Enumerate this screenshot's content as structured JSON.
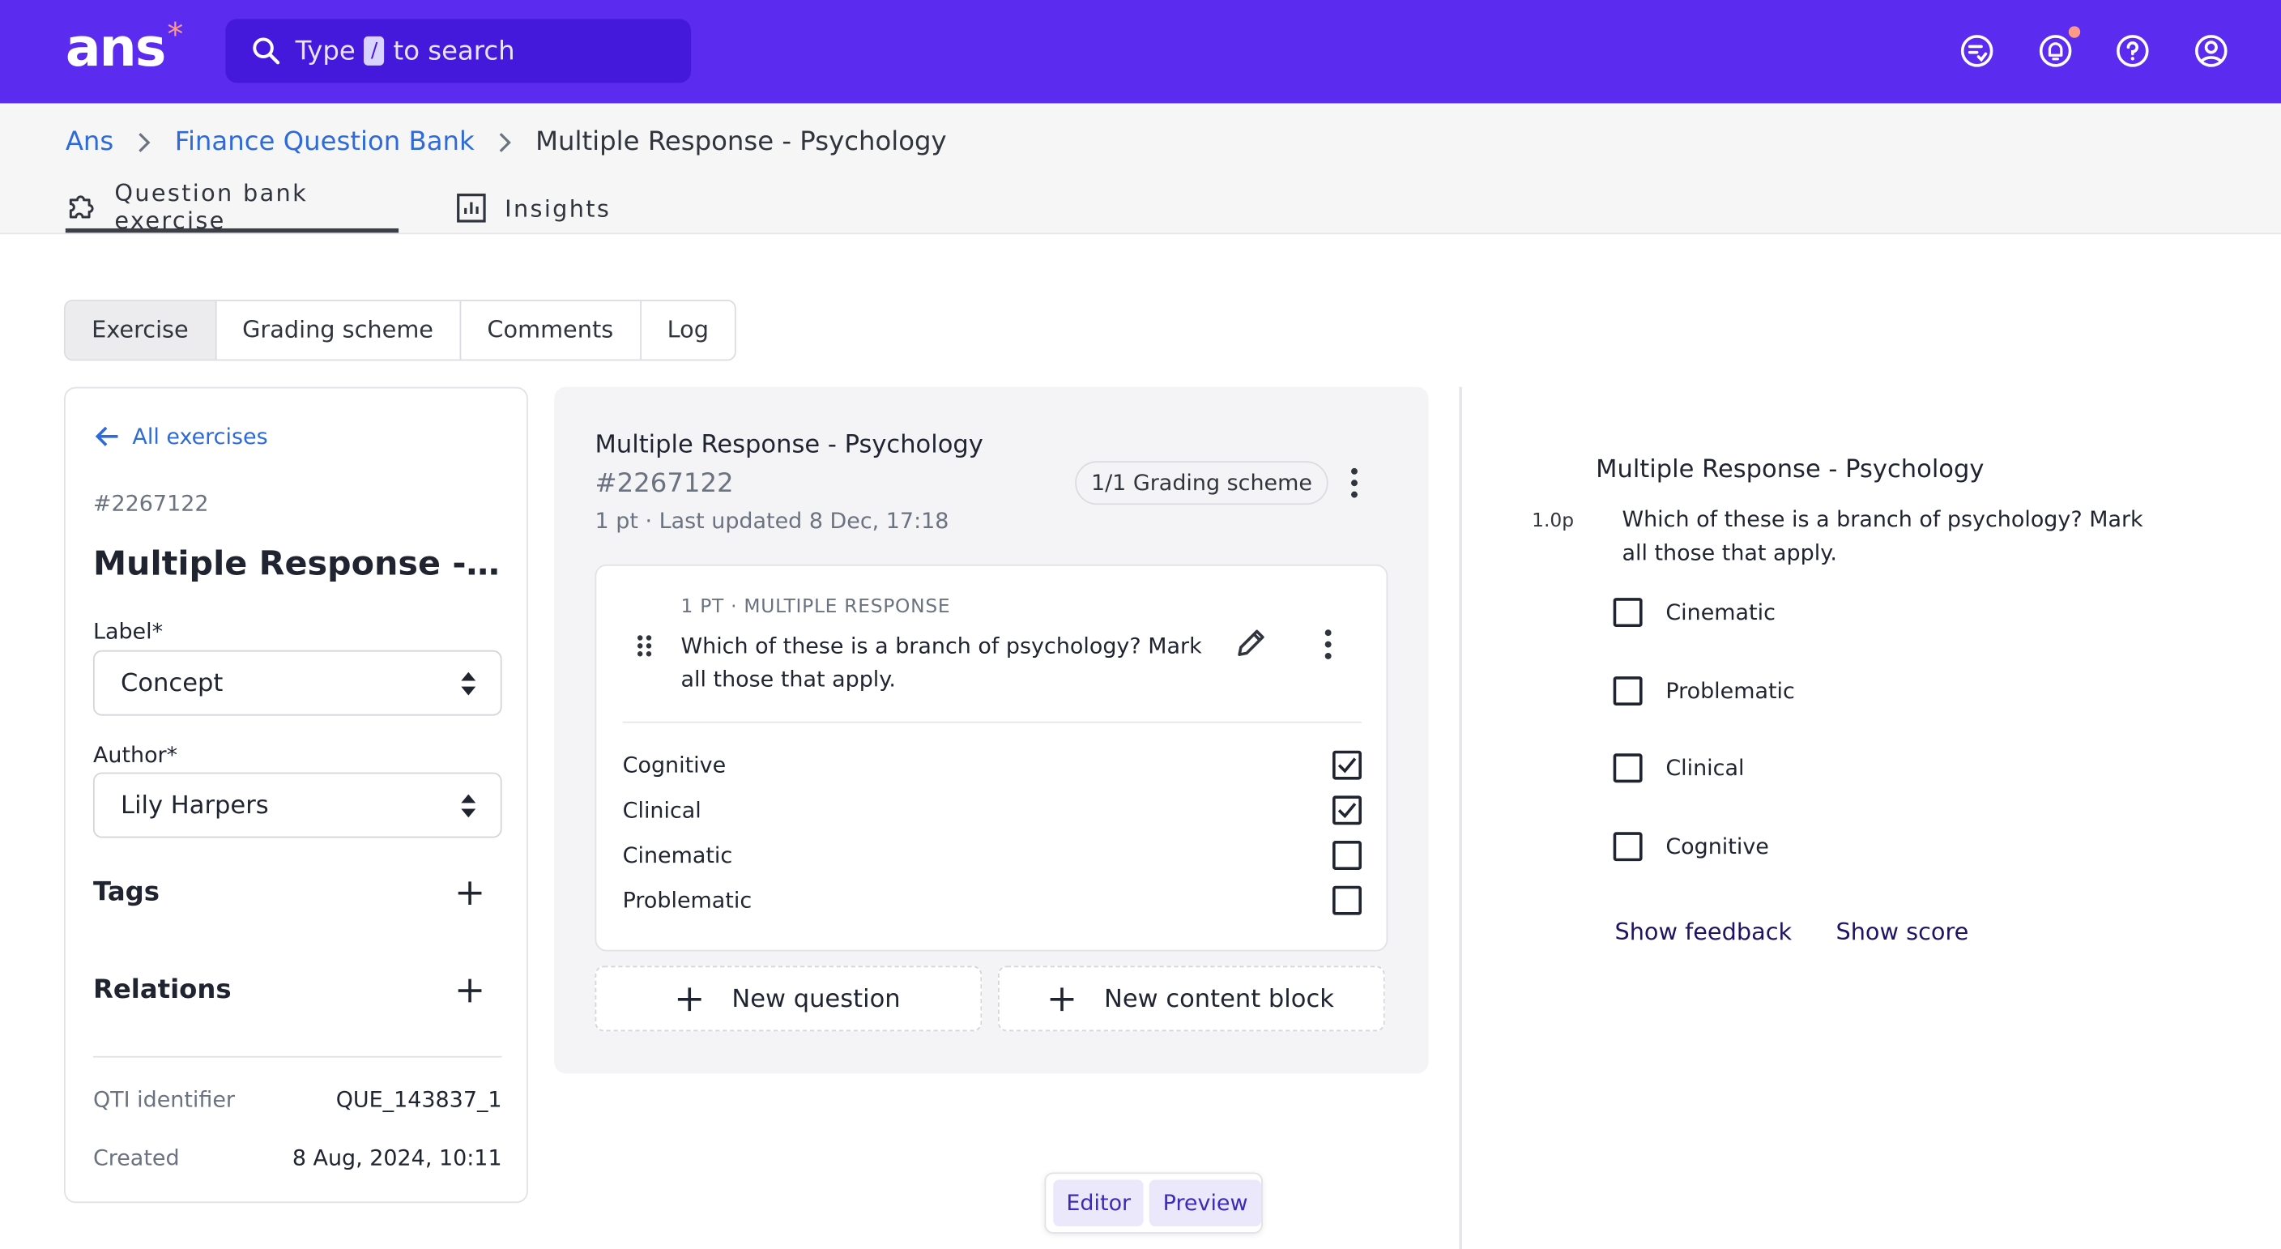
{
  "app": {
    "logo": "ans",
    "logo_star": "*",
    "search": {
      "prefix": "Type",
      "key": "/",
      "suffix": "to search"
    }
  },
  "breadcrumb": [
    "Ans",
    "Finance Question Bank",
    "Multiple Response - Psychology"
  ],
  "page_tabs": [
    "Question bank exercise",
    "Insights"
  ],
  "section_tabs": [
    "Exercise",
    "Grading scheme",
    "Comments",
    "Log"
  ],
  "left_panel": {
    "back_label": "All exercises",
    "exercise_id": "#2267122",
    "title": "Multiple Response - Psychology",
    "label_field": {
      "label": "Label*",
      "value": "Concept"
    },
    "author_field": {
      "label": "Author*",
      "value": "Lily Harpers"
    },
    "tags_label": "Tags",
    "relations_label": "Relations",
    "qti_key": "QTI identifier",
    "qti_value": "QUE_143837_1",
    "created_key": "Created",
    "created_value": "8 Aug, 2024, 10:11"
  },
  "editor": {
    "title": "Multiple Response - Psychology",
    "exercise_id": "#2267122",
    "meta": "1 pt · Last updated 8 Dec, 17:18",
    "grading_pill": "1/1 Grading scheme",
    "question": {
      "kicker": "1 PT · MULTIPLE RESPONSE",
      "text": "Which of these is a branch of psychology? Mark all those that apply.",
      "options": [
        {
          "label": "Cognitive",
          "checked": true
        },
        {
          "label": "Clinical",
          "checked": true
        },
        {
          "label": "Cinematic",
          "checked": false
        },
        {
          "label": "Problematic",
          "checked": false
        }
      ]
    },
    "new_question_label": "New question",
    "new_content_block_label": "New content block"
  },
  "view_toggle": {
    "editor_label": "Editor",
    "preview_label": "Preview"
  },
  "preview": {
    "title": "Multiple Response - Psychology",
    "points": "1.0p",
    "question": "Which of these is a branch of psychology? Mark all those that apply.",
    "options": [
      "Cinematic",
      "Problematic",
      "Clinical",
      "Cognitive"
    ],
    "show_feedback_label": "Show feedback",
    "show_score_label": "Show score"
  },
  "colors": {
    "brand": "#5b2bf0",
    "search_bg": "#4519dc",
    "link": "#2f6ad9",
    "notification_dot": "#ff9a86"
  },
  "icons": [
    "search-icon",
    "checklist-icon",
    "bell-icon",
    "help-icon",
    "account-icon",
    "chevron-right-icon",
    "puzzle-icon",
    "bar-chart-icon",
    "arrow-left-icon",
    "sort-icon",
    "plus-icon",
    "kebab-icon",
    "drag-handle-icon",
    "pencil-icon",
    "checkbox-icon"
  ]
}
